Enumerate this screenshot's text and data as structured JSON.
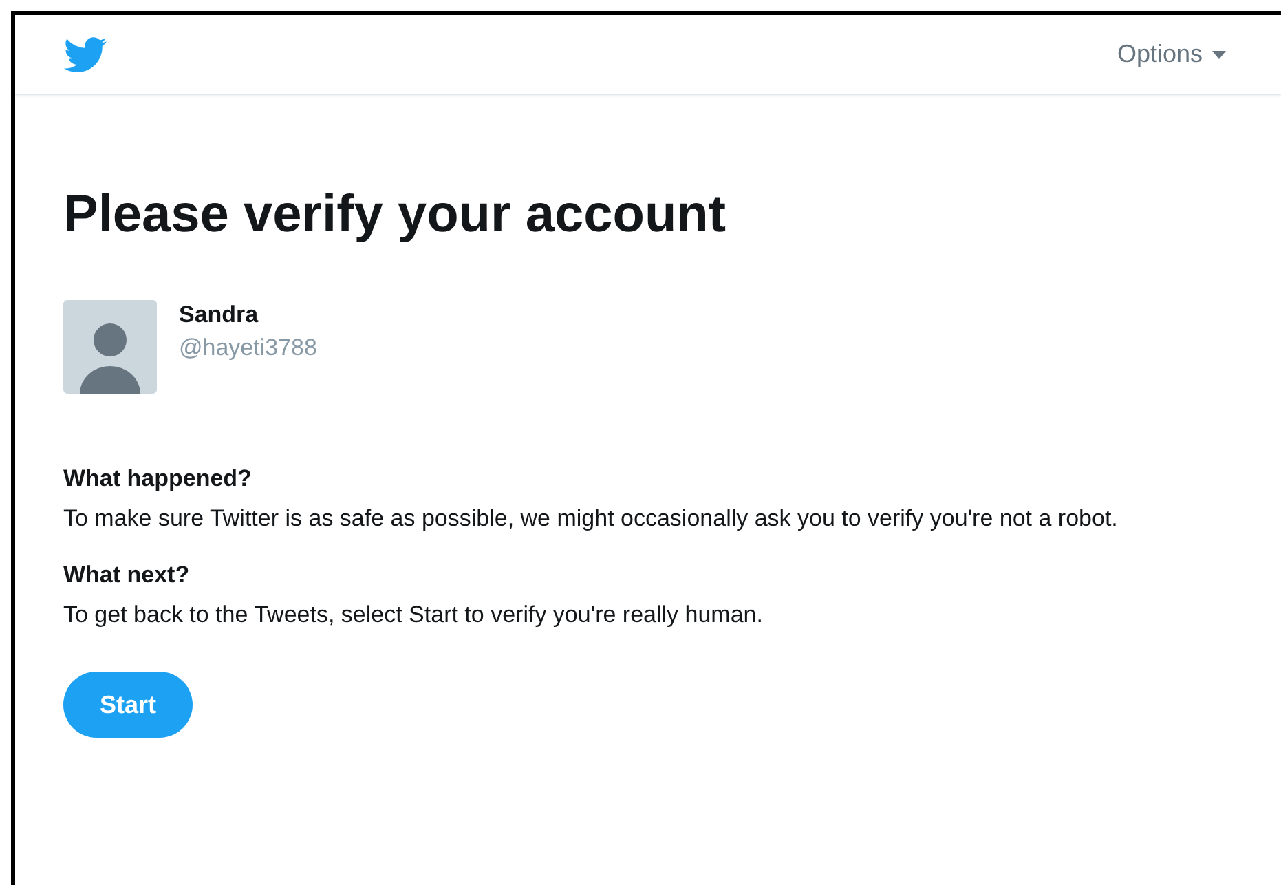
{
  "header": {
    "options_label": "Options"
  },
  "title": "Please verify your account",
  "account": {
    "name": "Sandra",
    "handle": "@hayeti3788"
  },
  "sections": [
    {
      "heading": "What happened?",
      "text": "To make sure Twitter is as safe as possible, we might occasionally ask you to verify you're not a robot."
    },
    {
      "heading": "What next?",
      "text": "To get back to the Tweets, select Start to verify you're really human."
    }
  ],
  "start_button": "Start"
}
